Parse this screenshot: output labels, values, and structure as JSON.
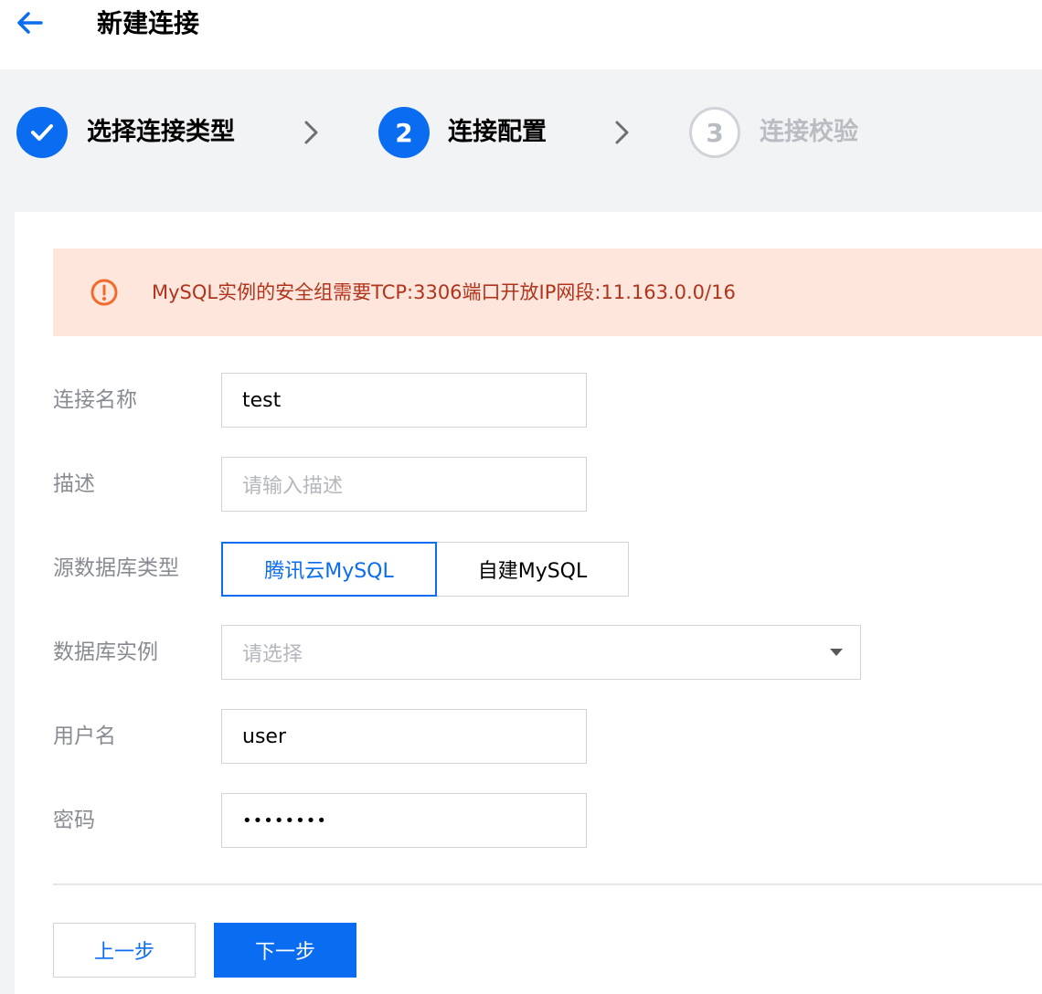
{
  "header": {
    "title": "新建连接",
    "back_icon": "arrow-left-icon"
  },
  "steps": [
    {
      "number": "",
      "label": "选择连接类型",
      "state": "done",
      "icon": "check-icon"
    },
    {
      "number": "2",
      "label": "连接配置",
      "state": "active"
    },
    {
      "number": "3",
      "label": "连接校验",
      "state": "pending"
    }
  ],
  "alert": {
    "icon": "warning-circle-icon",
    "text": "MySQL实例的安全组需要TCP:3306端口开放IP网段:11.163.0.0/16"
  },
  "form": {
    "name": {
      "label": "连接名称",
      "value": "test"
    },
    "description": {
      "label": "描述",
      "placeholder": "请输入描述"
    },
    "source_type": {
      "label": "源数据库类型",
      "options": [
        "腾讯云MySQL",
        "自建MySQL"
      ],
      "selected": "腾讯云MySQL"
    },
    "instance": {
      "label": "数据库实例",
      "placeholder": "请选择"
    },
    "username": {
      "label": "用户名",
      "value": "user"
    },
    "password": {
      "label": "密码",
      "value": "••••••••"
    }
  },
  "buttons": {
    "prev": "上一步",
    "next": "下一步"
  },
  "colors": {
    "primary": "#0a6cf0",
    "alert_bg": "#fee6dc",
    "alert_text": "#b1331b",
    "muted": "#b9bcc1"
  }
}
